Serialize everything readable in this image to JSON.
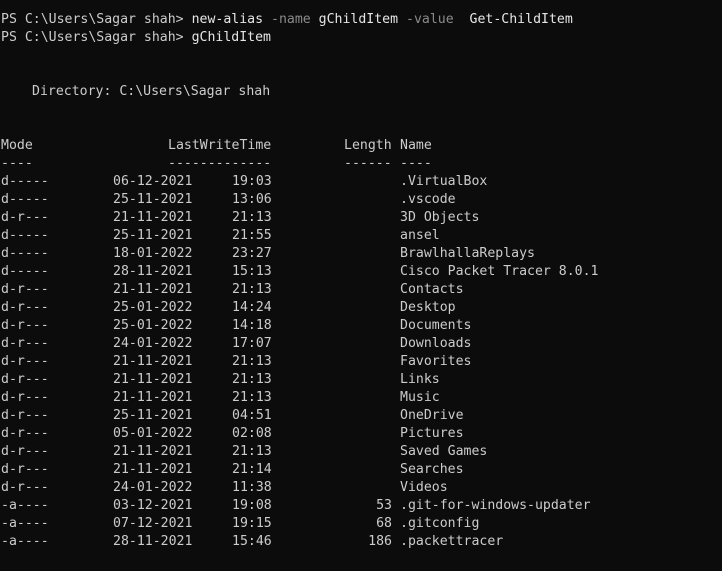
{
  "commands": [
    {
      "prompt": "PS C:\\Users\\Sagar shah>",
      "command": "new-alias",
      "param1": "-name",
      "arg1": "gChildItem",
      "param2": "-value",
      "arg2": "Get-ChildItem"
    },
    {
      "prompt": "PS C:\\Users\\Sagar shah>",
      "command": "gChildItem"
    }
  ],
  "directory_label": "Directory: C:\\Users\\Sagar shah",
  "headers": {
    "mode": "Mode",
    "lastwritetime": "LastWriteTime",
    "length": "Length",
    "name": "Name"
  },
  "underlines": {
    "mode": "----",
    "lastwritetime": "-------------",
    "length": "------",
    "name": "----"
  },
  "rows": [
    {
      "mode": "d-----",
      "date": "06-12-2021",
      "time": "19:03",
      "length": "",
      "name": ".VirtualBox"
    },
    {
      "mode": "d-----",
      "date": "25-11-2021",
      "time": "13:06",
      "length": "",
      "name": ".vscode"
    },
    {
      "mode": "d-r---",
      "date": "21-11-2021",
      "time": "21:13",
      "length": "",
      "name": "3D Objects"
    },
    {
      "mode": "d-----",
      "date": "25-11-2021",
      "time": "21:55",
      "length": "",
      "name": "ansel"
    },
    {
      "mode": "d-----",
      "date": "18-01-2022",
      "time": "23:27",
      "length": "",
      "name": "BrawlhallaReplays"
    },
    {
      "mode": "d-----",
      "date": "28-11-2021",
      "time": "15:13",
      "length": "",
      "name": "Cisco Packet Tracer 8.0.1"
    },
    {
      "mode": "d-r---",
      "date": "21-11-2021",
      "time": "21:13",
      "length": "",
      "name": "Contacts"
    },
    {
      "mode": "d-r---",
      "date": "25-01-2022",
      "time": "14:24",
      "length": "",
      "name": "Desktop"
    },
    {
      "mode": "d-r---",
      "date": "25-01-2022",
      "time": "14:18",
      "length": "",
      "name": "Documents"
    },
    {
      "mode": "d-r---",
      "date": "24-01-2022",
      "time": "17:07",
      "length": "",
      "name": "Downloads"
    },
    {
      "mode": "d-r---",
      "date": "21-11-2021",
      "time": "21:13",
      "length": "",
      "name": "Favorites"
    },
    {
      "mode": "d-r---",
      "date": "21-11-2021",
      "time": "21:13",
      "length": "",
      "name": "Links"
    },
    {
      "mode": "d-r---",
      "date": "21-11-2021",
      "time": "21:13",
      "length": "",
      "name": "Music"
    },
    {
      "mode": "d-r---",
      "date": "25-11-2021",
      "time": "04:51",
      "length": "",
      "name": "OneDrive"
    },
    {
      "mode": "d-r---",
      "date": "05-01-2022",
      "time": "02:08",
      "length": "",
      "name": "Pictures"
    },
    {
      "mode": "d-r---",
      "date": "21-11-2021",
      "time": "21:13",
      "length": "",
      "name": "Saved Games"
    },
    {
      "mode": "d-r---",
      "date": "21-11-2021",
      "time": "21:14",
      "length": "",
      "name": "Searches"
    },
    {
      "mode": "d-r---",
      "date": "24-01-2022",
      "time": "11:38",
      "length": "",
      "name": "Videos"
    },
    {
      "mode": "-a----",
      "date": "03-12-2021",
      "time": "19:08",
      "length": "53",
      "name": ".git-for-windows-updater"
    },
    {
      "mode": "-a----",
      "date": "07-12-2021",
      "time": "19:15",
      "length": "68",
      "name": ".gitconfig"
    },
    {
      "mode": "-a----",
      "date": "28-11-2021",
      "time": "15:46",
      "length": "186",
      "name": ".packettracer"
    }
  ],
  "colors": {
    "background": "#0c0c0c",
    "text": "#cccccc",
    "parameter": "#8a8a8a"
  }
}
